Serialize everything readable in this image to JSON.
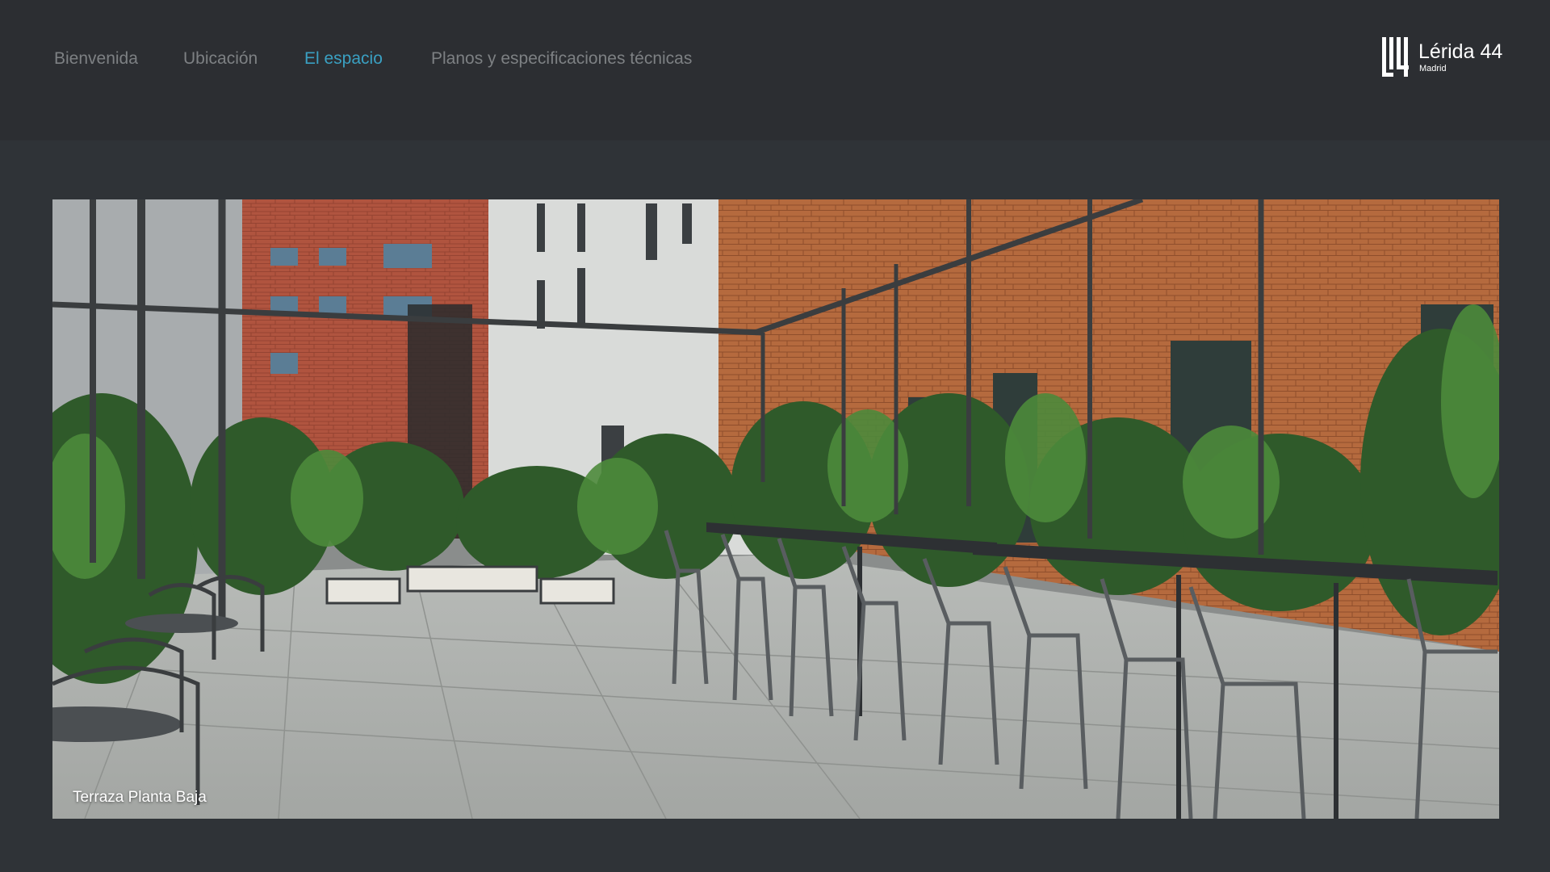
{
  "nav": {
    "items": [
      {
        "label": "Bienvenida"
      },
      {
        "label": "Ubicación"
      },
      {
        "label": "El espacio",
        "active": true
      },
      {
        "label": "Planos y especificaciones técnicas"
      }
    ]
  },
  "brand": {
    "title": "Lérida 44",
    "subtitle": "Madrid",
    "icon": "building-logo-icon"
  },
  "gallery": {
    "caption": "Terraza Planta Baja",
    "image": "terrace-photo"
  },
  "colors": {
    "header_bg": "#2c2e32",
    "page_bg": "#2f3337",
    "nav_text": "#7d8083",
    "nav_active": "#3aa0c2",
    "brand_text": "#ffffff"
  }
}
